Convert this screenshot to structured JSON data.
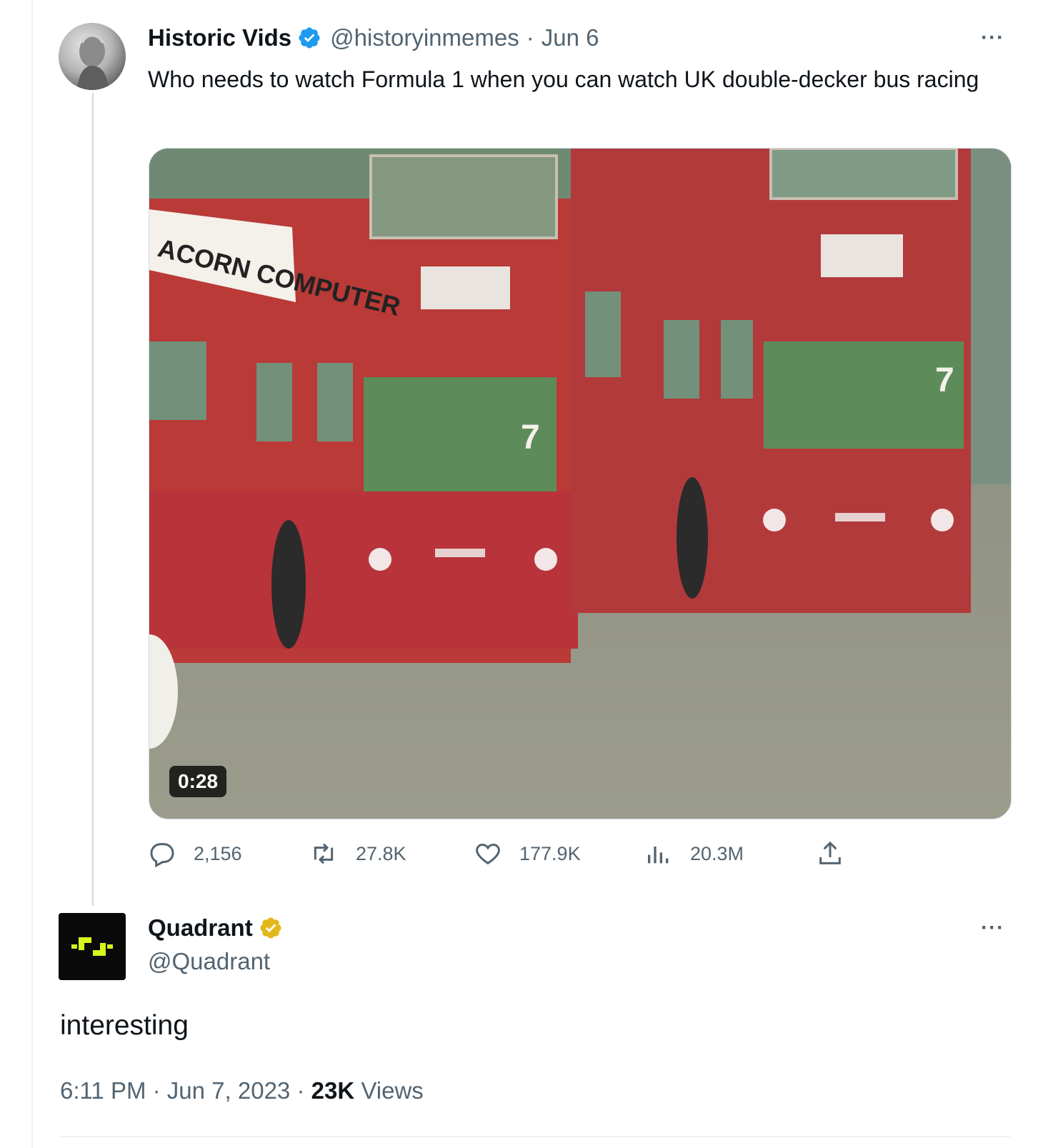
{
  "parent_tweet": {
    "display_name": "Historic Vids",
    "handle": "@historyinmemes",
    "date": "Jun 6",
    "separator": "·",
    "text": "Who needs to watch Formula 1 when you can watch UK double-decker bus racing",
    "media": {
      "duration": "0:28",
      "sign_text": "ACORN COMPUTER",
      "route_number": "7"
    },
    "stats": {
      "replies": "2,156",
      "retweets": "27.8K",
      "likes": "177.9K",
      "views": "20.3M"
    },
    "badge_color": "#1d9bf0"
  },
  "reply_tweet": {
    "display_name": "Quadrant",
    "handle": "@Quadrant",
    "text": "interesting",
    "time": "6:11 PM",
    "date": "Jun 7, 2023",
    "sep": "·",
    "views_count": "23K",
    "views_label": "Views",
    "badge_color": "#e2b719",
    "logo_color": "#d6f51a"
  },
  "icons": {
    "more": "more-icon",
    "reply": "reply-icon",
    "retweet": "retweet-icon",
    "like": "heart-icon",
    "views": "views-icon",
    "share": "share-icon",
    "verified": "verified-badge-icon"
  },
  "more_label": "···"
}
